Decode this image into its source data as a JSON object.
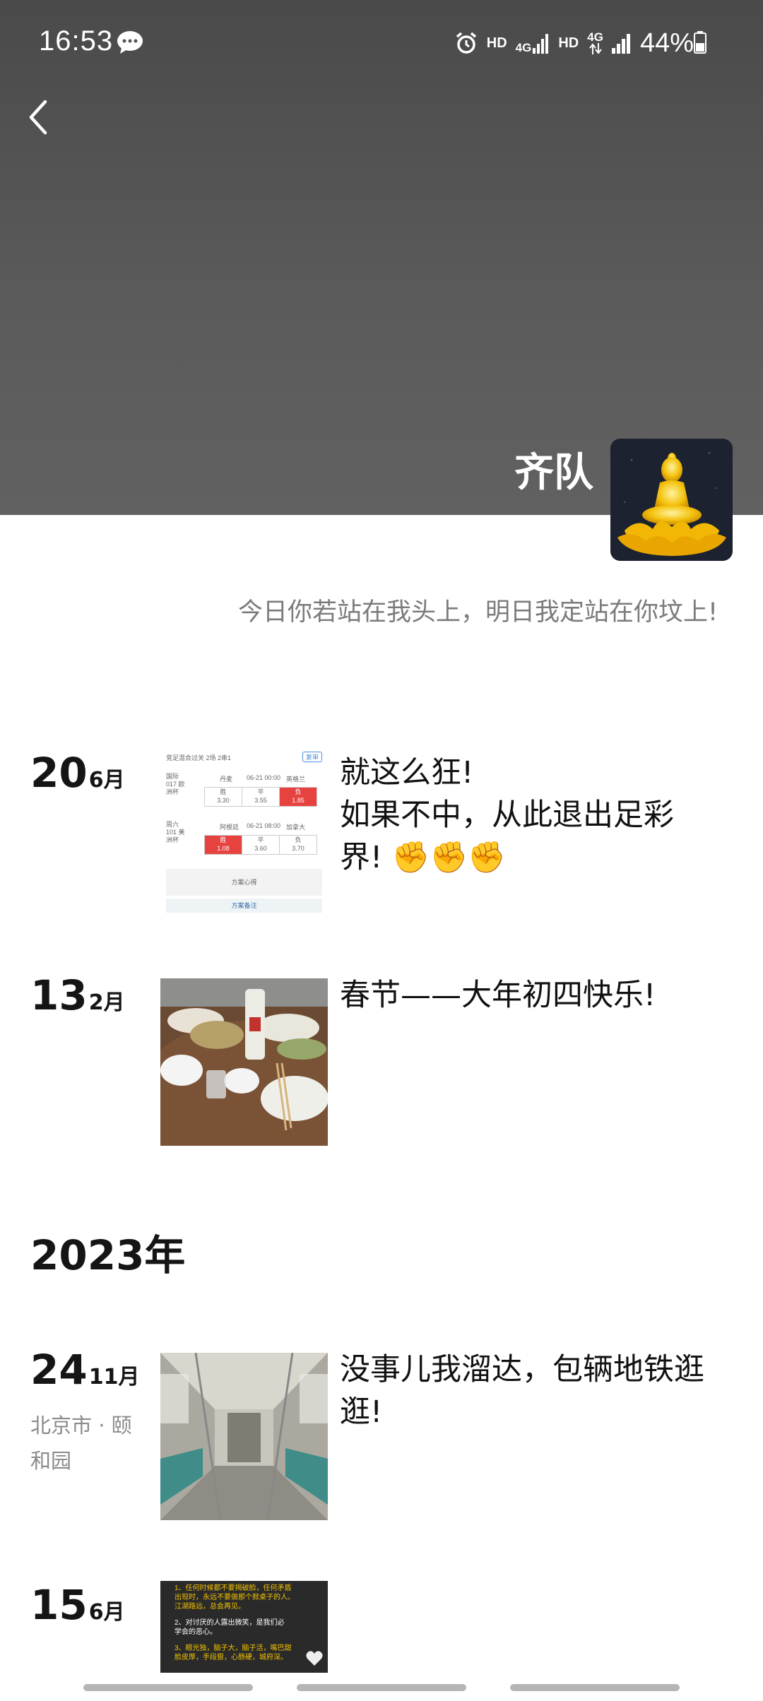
{
  "status_bar": {
    "time": "16:53",
    "hd1": "HD",
    "net1": "4G",
    "hd2": "HD",
    "net2": "4G",
    "battery": "44%"
  },
  "profile": {
    "name": "齐队",
    "signature": "今日你若站在我头上，明日我定站在你坟上!"
  },
  "posts": [
    {
      "day": "20",
      "month": "6月",
      "text_lines": [
        "就这么狂!",
        "如果不中，从此退出足彩",
        "界! ✊✊✊"
      ],
      "thumb": {
        "header": "竞足混合过关  2场 2串1",
        "tag": "复审",
        "row1": {
          "league": "国际017 欧洲杯",
          "home": "丹麦",
          "time": "06-21 00:00",
          "away": "英格兰",
          "opts": [
            "胜",
            "平",
            "负"
          ],
          "odds": [
            "3.30",
            "3.55",
            "1.85"
          ]
        },
        "row2": {
          "league": "周六101 美洲杯",
          "home": "阿根廷",
          "time": "06-21 08:00",
          "away": "加拿大",
          "opts": [
            "胜",
            "平",
            "负"
          ],
          "odds": [
            "1.08",
            "3.60",
            "3.70"
          ]
        },
        "note": "方案心得",
        "footer": "方案备注"
      }
    },
    {
      "day": "13",
      "month": "2月",
      "text_lines": [
        "春节——大年初四快乐!"
      ]
    },
    {
      "day": "24",
      "month": "11月",
      "location": "北京市 · 颐和园",
      "text_lines": [
        "没事儿我溜达，包辆地铁逛",
        "逛!"
      ]
    },
    {
      "day": "15",
      "month": "6月",
      "thumb_lines": [
        "1、任何时候都不要揭破脸，任何矛盾",
        "出现时，永远不要做那个掀桌子的人。",
        "江湖路远，总会再见。",
        "2、对讨厌的人露出微笑，是我们必",
        "学会的恶心。",
        "3、眼光独，脑子大，脑子活，嘴巴甜",
        "脸皮厚，手段狠，心肠硬，城府深。"
      ]
    }
  ],
  "year_header": "2023年",
  "colors": {
    "cover_gray": "#555555",
    "accent_red": "#e64340",
    "subtitle_gray": "#7b7b7b"
  }
}
